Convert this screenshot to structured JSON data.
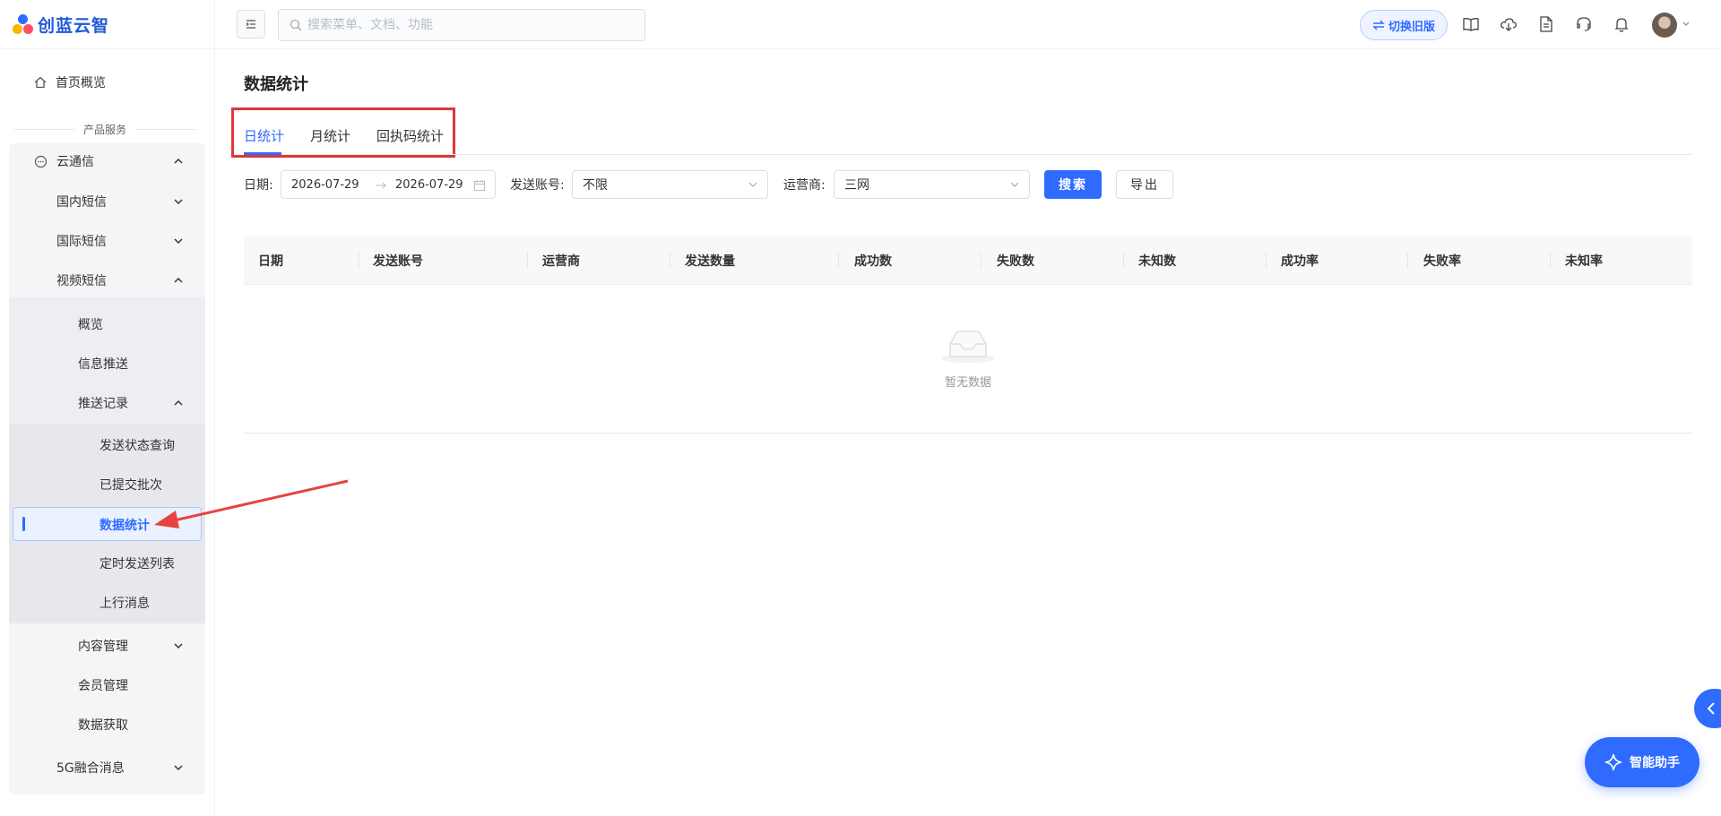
{
  "brand": {
    "name": "创蓝云智"
  },
  "header": {
    "search_placeholder": "搜索菜单、文档、功能",
    "switch_label": "切换旧版"
  },
  "sidebar": {
    "home": "首页概览",
    "group_title": "产品服务",
    "items": [
      {
        "label": "云通信"
      },
      {
        "label": "国内短信"
      },
      {
        "label": "国际短信"
      },
      {
        "label": "视频短信"
      },
      {
        "label": "概览"
      },
      {
        "label": "信息推送"
      },
      {
        "label": "推送记录"
      },
      {
        "label": "发送状态查询"
      },
      {
        "label": "已提交批次"
      },
      {
        "label": "数据统计"
      },
      {
        "label": "定时发送列表"
      },
      {
        "label": "上行消息"
      },
      {
        "label": "内容管理"
      },
      {
        "label": "会员管理"
      },
      {
        "label": "数据获取"
      },
      {
        "label": "5G融合消息"
      }
    ]
  },
  "main": {
    "title": "数据统计",
    "tabs": [
      {
        "label": "日统计"
      },
      {
        "label": "月统计"
      },
      {
        "label": "回执码统计"
      }
    ],
    "filters": {
      "date_label": "日期:",
      "date_start": "2026-07-29",
      "date_end": "2026-07-29",
      "account_label": "发送账号:",
      "account_value": "不限",
      "carrier_label": "运营商:",
      "carrier_value": "三网",
      "search_btn": "搜索",
      "export_btn": "导出"
    },
    "table": {
      "columns": [
        "日期",
        "发送账号",
        "运营商",
        "发送数量",
        "成功数",
        "失败数",
        "未知数",
        "成功率",
        "失败率",
        "未知率"
      ],
      "rows": [],
      "empty_text": "暂无数据"
    }
  },
  "assistant": {
    "label": "智能助手"
  },
  "colors": {
    "accent": "#2f6bff",
    "highlight_box": "#e0363a"
  }
}
